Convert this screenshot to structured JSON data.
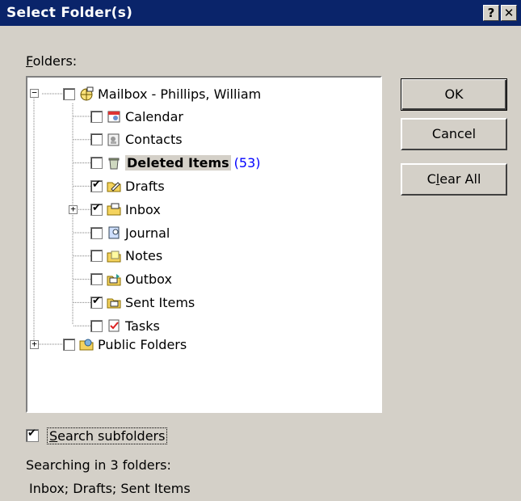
{
  "dialog": {
    "title": "Select Folder(s)",
    "help_label": "?",
    "close_label": "✕"
  },
  "folders_label": "Folders:",
  "tree": {
    "root": {
      "label": "Mailbox - Phillips, William",
      "checked": false,
      "icon": "mailbox-icon"
    },
    "items": [
      {
        "label": "Calendar",
        "checked": false,
        "icon": "calendar-icon"
      },
      {
        "label": "Contacts",
        "checked": false,
        "icon": "contacts-icon"
      },
      {
        "label": "Deleted Items",
        "count": "(53)",
        "checked": false,
        "icon": "deleted-items-icon",
        "selected": true
      },
      {
        "label": "Drafts",
        "checked": true,
        "icon": "drafts-icon"
      },
      {
        "label": "Inbox",
        "checked": true,
        "icon": "inbox-icon",
        "expandable": true
      },
      {
        "label": "Journal",
        "checked": false,
        "icon": "journal-icon"
      },
      {
        "label": "Notes",
        "checked": false,
        "icon": "notes-icon"
      },
      {
        "label": "Outbox",
        "checked": false,
        "icon": "outbox-icon"
      },
      {
        "label": "Sent Items",
        "checked": true,
        "icon": "sent-items-icon"
      },
      {
        "label": "Tasks",
        "checked": false,
        "icon": "tasks-icon"
      }
    ],
    "public": {
      "label": "Public Folders",
      "checked": false,
      "icon": "public-folders-icon",
      "expandable": true
    }
  },
  "buttons": {
    "ok": "OK",
    "cancel": "Cancel",
    "clear_all": "Clear All"
  },
  "search_subfolders": {
    "label": "Search subfolders",
    "checked": true
  },
  "status": {
    "line1": "Searching in 3 folders:",
    "line2": "Inbox; Drafts; Sent Items"
  },
  "colors": {
    "titlebar": "#0a246a",
    "face": "#d4d0c8",
    "count_text": "#0000ff"
  }
}
